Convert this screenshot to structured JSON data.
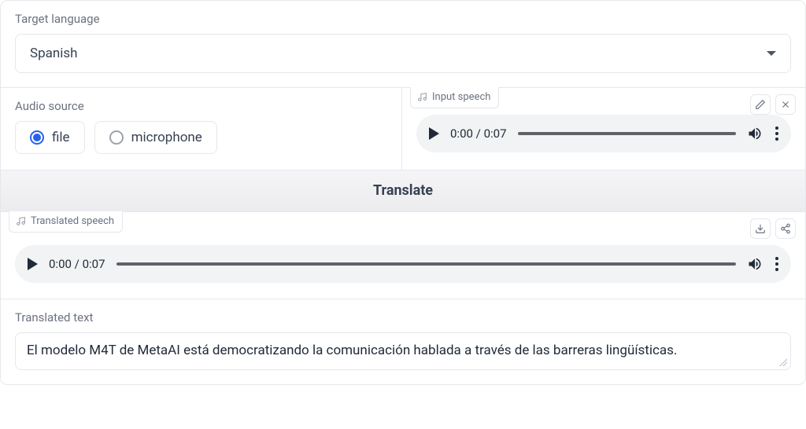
{
  "target_language": {
    "label": "Target language",
    "value": "Spanish"
  },
  "audio_source": {
    "label": "Audio source",
    "options": [
      {
        "label": "file",
        "selected": true
      },
      {
        "label": "microphone",
        "selected": false
      }
    ]
  },
  "input_speech": {
    "label": "Input speech",
    "current_time": "0:00",
    "duration": "0:07"
  },
  "translate_button": "Translate",
  "translated_speech": {
    "label": "Translated speech",
    "current_time": "0:00",
    "duration": "0:07"
  },
  "translated_text": {
    "label": "Translated text",
    "value": "El modelo M4T de MetaAI está democratizando la comunicación hablada a través de las barreras lingüísticas."
  }
}
